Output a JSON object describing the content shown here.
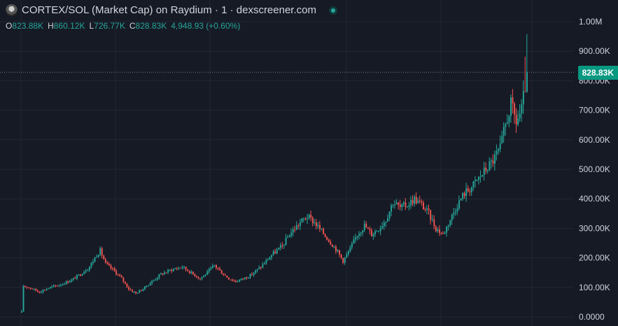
{
  "header": {
    "title": "CORTEX/SOL (Market Cap) on Raydium · 1 · dexscreener.com",
    "logo_icon": "token-logo-icon",
    "status_icon": "live-status-icon"
  },
  "ohlc": {
    "open_label": "O",
    "open": "823.88K",
    "high_label": "H",
    "high": "860.12K",
    "low_label": "L",
    "low": "726.77K",
    "close_label": "C",
    "close": "828.83K",
    "change": "4,948.93 (+0.60%)"
  },
  "current_price": "828.83K",
  "colors": {
    "background": "#161a25",
    "grid": "#232733",
    "up": "#26a69a",
    "down": "#ef5350",
    "price_tag": "#089981",
    "text": "#d1d4dc"
  },
  "chart_data": {
    "type": "candlestick",
    "title": "CORTEX/SOL (Market Cap) on Raydium · 1 · dexscreener.com",
    "xlabel": "",
    "ylabel": "",
    "ylim": [
      0,
      1000000
    ],
    "y_ticks": [
      {
        "value": 1000000,
        "label": "1.00M"
      },
      {
        "value": 900000,
        "label": "900.00K"
      },
      {
        "value": 800000,
        "label": "800.00K"
      },
      {
        "value": 700000,
        "label": "700.00K"
      },
      {
        "value": 600000,
        "label": "600.00K"
      },
      {
        "value": 500000,
        "label": "500.00K"
      },
      {
        "value": 400000,
        "label": "400.00K"
      },
      {
        "value": 300000,
        "label": "300.00K"
      },
      {
        "value": 200000,
        "label": "200.00K"
      },
      {
        "value": 100000,
        "label": "100.00K"
      },
      {
        "value": 0,
        "label": "0.0000"
      }
    ],
    "grid": true,
    "current_value": 828830,
    "close_path": [
      [
        0,
        15000
      ],
      [
        1,
        105000
      ],
      [
        4,
        100000
      ],
      [
        10,
        85000
      ],
      [
        16,
        100000
      ],
      [
        22,
        110000
      ],
      [
        28,
        125000
      ],
      [
        33,
        145000
      ],
      [
        38,
        170000
      ],
      [
        42,
        210000
      ],
      [
        44,
        225000
      ],
      [
        47,
        180000
      ],
      [
        52,
        155000
      ],
      [
        56,
        130000
      ],
      [
        60,
        95000
      ],
      [
        64,
        80000
      ],
      [
        68,
        95000
      ],
      [
        73,
        120000
      ],
      [
        78,
        145000
      ],
      [
        84,
        160000
      ],
      [
        90,
        170000
      ],
      [
        96,
        145000
      ],
      [
        100,
        130000
      ],
      [
        104,
        150000
      ],
      [
        108,
        175000
      ],
      [
        112,
        150000
      ],
      [
        116,
        130000
      ],
      [
        120,
        120000
      ],
      [
        124,
        130000
      ],
      [
        128,
        140000
      ],
      [
        134,
        170000
      ],
      [
        140,
        210000
      ],
      [
        146,
        240000
      ],
      [
        150,
        280000
      ],
      [
        156,
        320000
      ],
      [
        160,
        340000
      ],
      [
        164,
        320000
      ],
      [
        168,
        290000
      ],
      [
        172,
        260000
      ],
      [
        176,
        230000
      ],
      [
        180,
        190000
      ],
      [
        184,
        230000
      ],
      [
        188,
        280000
      ],
      [
        192,
        310000
      ],
      [
        196,
        280000
      ],
      [
        200,
        300000
      ],
      [
        204,
        330000
      ],
      [
        208,
        390000
      ],
      [
        212,
        370000
      ],
      [
        216,
        380000
      ],
      [
        220,
        400000
      ],
      [
        224,
        380000
      ],
      [
        228,
        350000
      ],
      [
        232,
        300000
      ],
      [
        236,
        280000
      ],
      [
        240,
        330000
      ],
      [
        244,
        380000
      ],
      [
        248,
        420000
      ],
      [
        252,
        440000
      ],
      [
        256,
        470000
      ],
      [
        260,
        500000
      ],
      [
        264,
        530000
      ],
      [
        268,
        570000
      ],
      [
        271,
        650000
      ],
      [
        274,
        720000
      ],
      [
        277,
        660000
      ],
      [
        280,
        700000
      ],
      [
        282,
        780000
      ],
      [
        283,
        828830
      ]
    ]
  }
}
